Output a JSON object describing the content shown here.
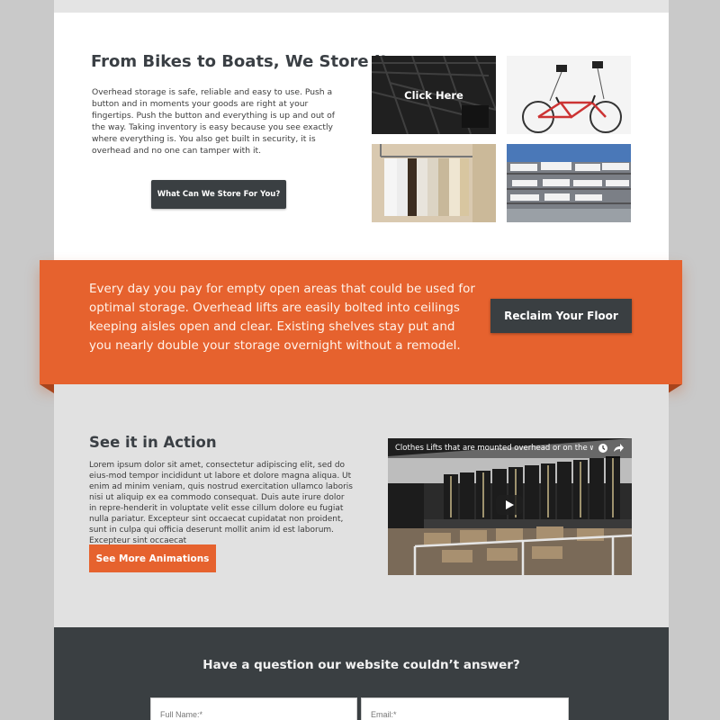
{
  "store_section": {
    "title": "From Bikes to Boats, We Store It",
    "body": "Overhead storage is safe, reliable and easy to use. Push a button and in moments your goods are right at your fingertips. Push the button and everything is up and out of the way. Taking inventory is easy because you see exactly where everything is. You also get built in security, it is overhead and no one can tamper with it.",
    "button_label": "What Can We Store For You?",
    "gallery": [
      {
        "overlay_label": "Click Here",
        "icon": "ceiling-rack-image"
      },
      {
        "icon": "bicycle-lift-image"
      },
      {
        "icon": "clothes-rack-image"
      },
      {
        "icon": "boat-storage-image"
      }
    ]
  },
  "banner": {
    "text": "Every day you pay for empty open areas that could be used for optimal storage. Overhead lifts are easily bolted into ceilings keeping aisles open and clear. Existing shelves stay put and you nearly double your storage overnight without a remodel.",
    "button_label": "Reclaim Your Floor",
    "color": "#e6622e"
  },
  "action_section": {
    "title": "See it in Action",
    "body": "Lorem ipsum dolor sit amet, consectetur adipiscing elit, sed do eius-mod tempor incididunt ut labore et dolore magna aliqua. Ut enim ad minim veniam, quis nostrud exercitation ullamco laboris nisi ut aliquip ex ea commodo consequat. Duis aute irure dolor in repre-henderit in voluptate velit esse cillum dolore eu fugiat nulla pariatur. Excepteur sint occaecat cupidatat non proident, sunt in culpa qui officia deserunt mollit anim id est laborum. Excepteur sint occaecat",
    "button_label": "See More Animations",
    "video": {
      "title": "Clothes Lifts that are mounted overhead or on the wall.",
      "icons": [
        "play-icon",
        "watch-later-icon",
        "share-icon"
      ]
    }
  },
  "contact": {
    "title": "Have a question our website couldn’t answer?",
    "fields": [
      {
        "placeholder": "Full Name:*"
      },
      {
        "placeholder": "Email:*"
      }
    ]
  }
}
